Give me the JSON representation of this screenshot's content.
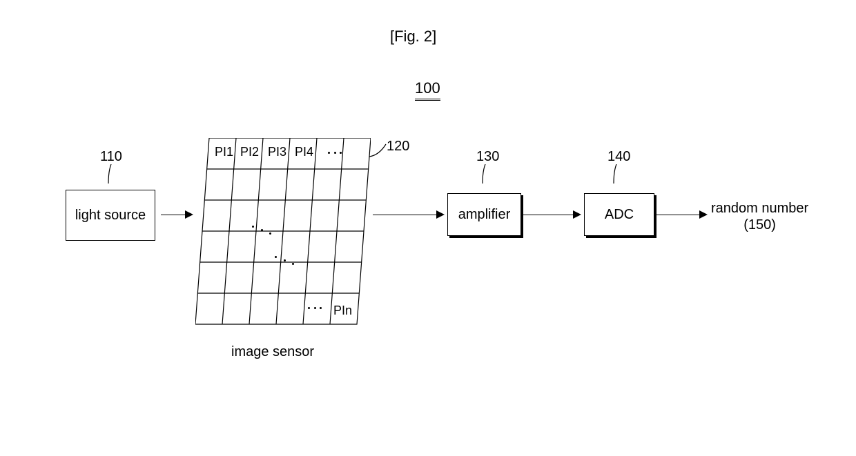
{
  "figure": {
    "title": "[Fig. 2]",
    "system_ref": "100"
  },
  "blocks": {
    "light_source": {
      "ref": "110",
      "label": "light source"
    },
    "image_sensor": {
      "ref": "120",
      "caption": "image sensor",
      "pixels": {
        "p1": "PI1",
        "p2": "PI2",
        "p3": "PI3",
        "p4": "PI4",
        "pn": "PIn"
      }
    },
    "amplifier": {
      "ref": "130",
      "label": "amplifier"
    },
    "adc": {
      "ref": "140",
      "label": "ADC"
    },
    "output": {
      "ref": "(150)",
      "label": "random number"
    }
  }
}
